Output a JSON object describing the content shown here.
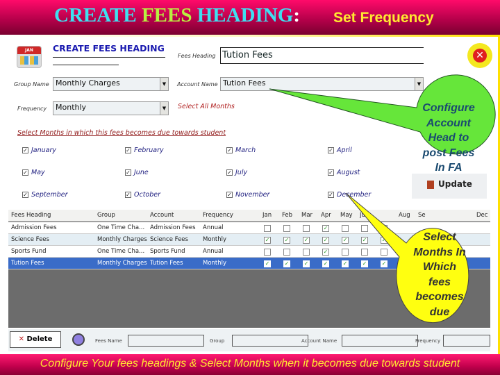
{
  "slide": {
    "title_part1": "CREATE ",
    "title_part2": "FEES ",
    "title_part3": "HEADING",
    "colon": ":",
    "subtitle": "Set Frequency",
    "footer": "Configure Your fees headings & Select Months when it becomes due towards student"
  },
  "form": {
    "heading": "CREATE FEES HEADING",
    "fees_heading_label": "Fees Heading",
    "fees_heading_value": "Tution Fees",
    "group_label": "Group Name",
    "group_value": "Monthly Charges",
    "account_label": "Account Name",
    "account_value": "Tution Fees",
    "frequency_label": "Frequency",
    "frequency_value": "Monthly",
    "select_all": "Select All Months",
    "months_caption": "Select Months in which this fees becomes due towards student",
    "update_label": "Update",
    "icons": {
      "calendar": "calendar-icon",
      "close": "close-icon"
    },
    "months": [
      {
        "label": "January",
        "checked": true
      },
      {
        "label": "February",
        "checked": true
      },
      {
        "label": "March",
        "checked": true
      },
      {
        "label": "April",
        "checked": true
      },
      {
        "label": "May",
        "checked": true
      },
      {
        "label": "June",
        "checked": true
      },
      {
        "label": "July",
        "checked": true
      },
      {
        "label": "August",
        "checked": true
      },
      {
        "label": "September",
        "checked": true
      },
      {
        "label": "October",
        "checked": true
      },
      {
        "label": "November",
        "checked": true
      },
      {
        "label": "December",
        "checked": true
      }
    ]
  },
  "table": {
    "columns": [
      "Fees Heading",
      "Group",
      "Account",
      "Frequency",
      "Jan",
      "Feb",
      "Mar",
      "Apr",
      "May",
      "Jun",
      "",
      "Aug",
      "Se",
      "",
      "",
      "Dec"
    ],
    "rows": [
      {
        "heading": "Admission Fees",
        "group": "One Time Cha...",
        "account": "Admission Fees",
        "frequency": "Annual",
        "months": [
          false,
          false,
          false,
          true,
          false,
          false,
          false
        ]
      },
      {
        "heading": "Science Fees",
        "group": "Monthly Charges",
        "account": "Science Fees",
        "frequency": "Monthly",
        "months": [
          true,
          true,
          true,
          true,
          true,
          true,
          true
        ]
      },
      {
        "heading": "Sports Fund",
        "group": "One Time Cha...",
        "account": "Sports Fund",
        "frequency": "Annual",
        "months": [
          false,
          false,
          false,
          true,
          false,
          false,
          false
        ]
      },
      {
        "heading": "Tution Fees",
        "group": "Monthly Charges",
        "account": "Tution Fees",
        "frequency": "Monthly",
        "months": [
          true,
          true,
          true,
          true,
          true,
          true,
          true
        ],
        "selected": true
      }
    ]
  },
  "bottom": {
    "delete_label": "Delete",
    "fees_name_label": "Fees Name",
    "group_label": "Group",
    "account_name_label": "Account Name",
    "frequency_label": "Frequency",
    "search_icon": "search-icon"
  },
  "callouts": {
    "account": "Configure\nAccount\nHead to\npost Fees\nIn FA",
    "months": "Select\nMonths In\nWhich\nfees\nbecomes\ndue"
  },
  "colors": {
    "banner": "#e0005a",
    "callout_green": "#66e63a",
    "callout_yellow": "#ffff10",
    "selected_row": "#3a6cc8"
  }
}
